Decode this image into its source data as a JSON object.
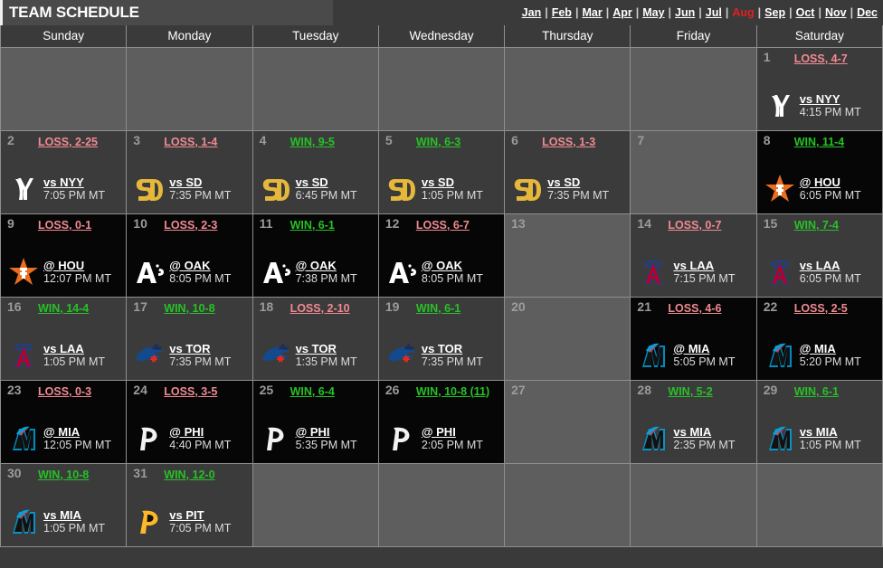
{
  "header": {
    "title": "TEAM SCHEDULE",
    "months": [
      {
        "label": "Jan",
        "active": false
      },
      {
        "label": "Feb",
        "active": false
      },
      {
        "label": "Mar",
        "active": false
      },
      {
        "label": "Apr",
        "active": false
      },
      {
        "label": "May",
        "active": false
      },
      {
        "label": "Jun",
        "active": false
      },
      {
        "label": "Jul",
        "active": false
      },
      {
        "label": "Aug",
        "active": true
      },
      {
        "label": "Sep",
        "active": false
      },
      {
        "label": "Oct",
        "active": false
      },
      {
        "label": "Nov",
        "active": false
      },
      {
        "label": "Dec",
        "active": false
      }
    ],
    "separator": "|"
  },
  "colors": {
    "win": "#27c127",
    "loss": "#f08a92",
    "active_month": "#e02020",
    "off_day_bg": "#5e5e5e",
    "home_bg": "#3b3b3b",
    "away_bg": "#060606",
    "grid": "#8e8e8e"
  },
  "weekdays": [
    "Sunday",
    "Monday",
    "Tuesday",
    "Wednesday",
    "Thursday",
    "Friday",
    "Saturday"
  ],
  "weeks": [
    [
      {
        "kind": "empty"
      },
      {
        "kind": "empty"
      },
      {
        "kind": "empty"
      },
      {
        "kind": "empty"
      },
      {
        "kind": "empty"
      },
      {
        "kind": "empty"
      },
      {
        "kind": "game",
        "day": "1",
        "result": "LOSS, 4-7",
        "outcome": "loss",
        "opponent": "vs NYY",
        "team": "NYY",
        "time": "4:15 PM MT",
        "venue": "home"
      }
    ],
    [
      {
        "kind": "game",
        "day": "2",
        "result": "LOSS, 2-25",
        "outcome": "loss",
        "opponent": "vs NYY",
        "team": "NYY",
        "time": "7:05 PM MT",
        "venue": "home"
      },
      {
        "kind": "game",
        "day": "3",
        "result": "LOSS, 1-4",
        "outcome": "loss",
        "opponent": "vs SD",
        "team": "SD",
        "time": "7:35 PM MT",
        "venue": "home"
      },
      {
        "kind": "game",
        "day": "4",
        "result": "WIN, 9-5",
        "outcome": "win",
        "opponent": "vs SD",
        "team": "SD",
        "time": "6:45 PM MT",
        "venue": "home"
      },
      {
        "kind": "game",
        "day": "5",
        "result": "WIN, 6-3",
        "outcome": "win",
        "opponent": "vs SD",
        "team": "SD",
        "time": "1:05 PM MT",
        "venue": "home"
      },
      {
        "kind": "game",
        "day": "6",
        "result": "LOSS, 1-3",
        "outcome": "loss",
        "opponent": "vs SD",
        "team": "SD",
        "time": "7:35 PM MT",
        "venue": "home"
      },
      {
        "kind": "off",
        "day": "7"
      },
      {
        "kind": "game",
        "day": "8",
        "result": "WIN, 11-4",
        "outcome": "win",
        "opponent": "@ HOU",
        "team": "HOU",
        "time": "6:05 PM MT",
        "venue": "away"
      }
    ],
    [
      {
        "kind": "game",
        "day": "9",
        "result": "LOSS, 0-1",
        "outcome": "loss",
        "opponent": "@ HOU",
        "team": "HOU",
        "time": "12:07 PM MT",
        "venue": "away"
      },
      {
        "kind": "game",
        "day": "10",
        "result": "LOSS, 2-3",
        "outcome": "loss",
        "opponent": "@ OAK",
        "team": "OAK",
        "time": "8:05 PM MT",
        "venue": "away"
      },
      {
        "kind": "game",
        "day": "11",
        "result": "WIN, 6-1",
        "outcome": "win",
        "opponent": "@ OAK",
        "team": "OAK",
        "time": "7:38 PM MT",
        "venue": "away"
      },
      {
        "kind": "game",
        "day": "12",
        "result": "LOSS, 6-7",
        "outcome": "loss",
        "opponent": "@ OAK",
        "team": "OAK",
        "time": "8:05 PM MT",
        "venue": "away"
      },
      {
        "kind": "off",
        "day": "13"
      },
      {
        "kind": "game",
        "day": "14",
        "result": "LOSS, 0-7",
        "outcome": "loss",
        "opponent": "vs LAA",
        "team": "LAA",
        "time": "7:15 PM MT",
        "venue": "home"
      },
      {
        "kind": "game",
        "day": "15",
        "result": "WIN, 7-4",
        "outcome": "win",
        "opponent": "vs LAA",
        "team": "LAA",
        "time": "6:05 PM MT",
        "venue": "home"
      }
    ],
    [
      {
        "kind": "game",
        "day": "16",
        "result": "WIN, 14-4",
        "outcome": "win",
        "opponent": "vs LAA",
        "team": "LAA",
        "time": "1:05 PM MT",
        "venue": "home"
      },
      {
        "kind": "game",
        "day": "17",
        "result": "WIN, 10-8",
        "outcome": "win",
        "opponent": "vs TOR",
        "team": "TOR",
        "time": "7:35 PM MT",
        "venue": "home"
      },
      {
        "kind": "game",
        "day": "18",
        "result": "LOSS, 2-10",
        "outcome": "loss",
        "opponent": "vs TOR",
        "team": "TOR",
        "time": "1:35 PM MT",
        "venue": "home"
      },
      {
        "kind": "game",
        "day": "19",
        "result": "WIN, 6-1",
        "outcome": "win",
        "opponent": "vs TOR",
        "team": "TOR",
        "time": "7:35 PM MT",
        "venue": "home"
      },
      {
        "kind": "off",
        "day": "20"
      },
      {
        "kind": "game",
        "day": "21",
        "result": "LOSS, 4-6",
        "outcome": "loss",
        "opponent": "@ MIA",
        "team": "MIA",
        "time": "5:05 PM MT",
        "venue": "away"
      },
      {
        "kind": "game",
        "day": "22",
        "result": "LOSS, 2-5",
        "outcome": "loss",
        "opponent": "@ MIA",
        "team": "MIA",
        "time": "5:20 PM MT",
        "venue": "away"
      }
    ],
    [
      {
        "kind": "game",
        "day": "23",
        "result": "LOSS, 0-3",
        "outcome": "loss",
        "opponent": "@ MIA",
        "team": "MIA",
        "time": "12:05 PM MT",
        "venue": "away"
      },
      {
        "kind": "game",
        "day": "24",
        "result": "LOSS, 3-5",
        "outcome": "loss",
        "opponent": "@ PHI",
        "team": "PHI",
        "time": "4:40 PM MT",
        "venue": "away"
      },
      {
        "kind": "game",
        "day": "25",
        "result": "WIN, 6-4",
        "outcome": "win",
        "opponent": "@ PHI",
        "team": "PHI",
        "time": "5:35 PM MT",
        "venue": "away"
      },
      {
        "kind": "game",
        "day": "26",
        "result": "WIN, 10-8 (11)",
        "outcome": "win",
        "opponent": "@ PHI",
        "team": "PHI",
        "time": "2:05 PM MT",
        "venue": "away"
      },
      {
        "kind": "off",
        "day": "27"
      },
      {
        "kind": "game",
        "day": "28",
        "result": "WIN, 5-2",
        "outcome": "win",
        "opponent": "vs MIA",
        "team": "MIA",
        "time": "2:35 PM MT",
        "venue": "home"
      },
      {
        "kind": "game",
        "day": "29",
        "result": "WIN, 6-1",
        "outcome": "win",
        "opponent": "vs MIA",
        "team": "MIA",
        "time": "1:05 PM MT",
        "venue": "home"
      }
    ],
    [
      {
        "kind": "game",
        "day": "30",
        "result": "WIN, 10-8",
        "outcome": "win",
        "opponent": "vs MIA",
        "team": "MIA",
        "time": "1:05 PM MT",
        "venue": "home"
      },
      {
        "kind": "game",
        "day": "31",
        "result": "WIN, 12-0",
        "outcome": "win",
        "opponent": "vs PIT",
        "team": "PIT",
        "time": "7:05 PM MT",
        "venue": "home"
      },
      {
        "kind": "empty"
      },
      {
        "kind": "empty"
      },
      {
        "kind": "empty"
      },
      {
        "kind": "empty"
      },
      {
        "kind": "empty"
      }
    ]
  ]
}
